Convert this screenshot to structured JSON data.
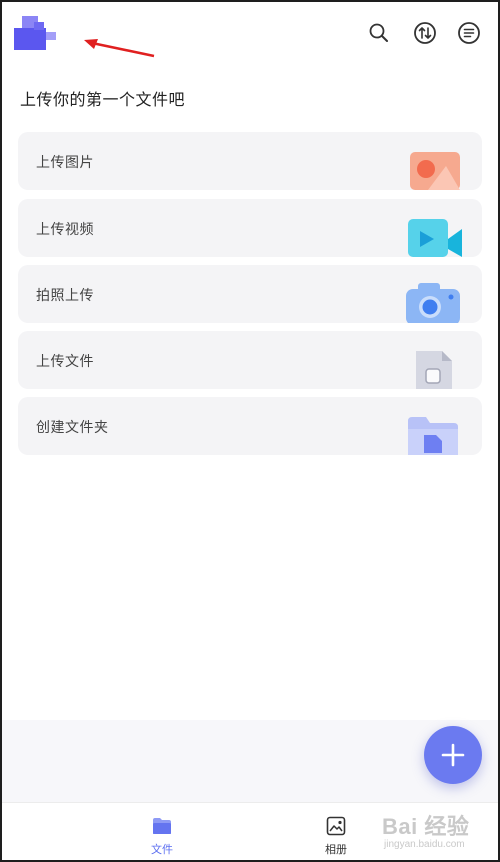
{
  "header": {
    "title": "上传你的第一个文件吧",
    "icons": [
      "search-icon",
      "transfer-icon",
      "menu-icon"
    ]
  },
  "cards": [
    {
      "label": "上传图片",
      "icon": "image-icon"
    },
    {
      "label": "上传视频",
      "icon": "video-icon"
    },
    {
      "label": "拍照上传",
      "icon": "camera-icon"
    },
    {
      "label": "上传文件",
      "icon": "file-icon"
    },
    {
      "label": "创建文件夹",
      "icon": "folder-icon"
    }
  ],
  "bottom_nav": {
    "items": [
      {
        "label": "文件",
        "icon": "folder-icon",
        "active": true
      },
      {
        "label": "相册",
        "icon": "album-icon",
        "active": false
      }
    ]
  },
  "watermark": {
    "main": "Bai 经验",
    "sub": "jingyan.baidu.com"
  },
  "colors": {
    "accent": "#6b7af0",
    "active_tab": "#5b6ef0",
    "card_bg": "#f4f4f6",
    "annotation_arrow": "#e02020"
  }
}
